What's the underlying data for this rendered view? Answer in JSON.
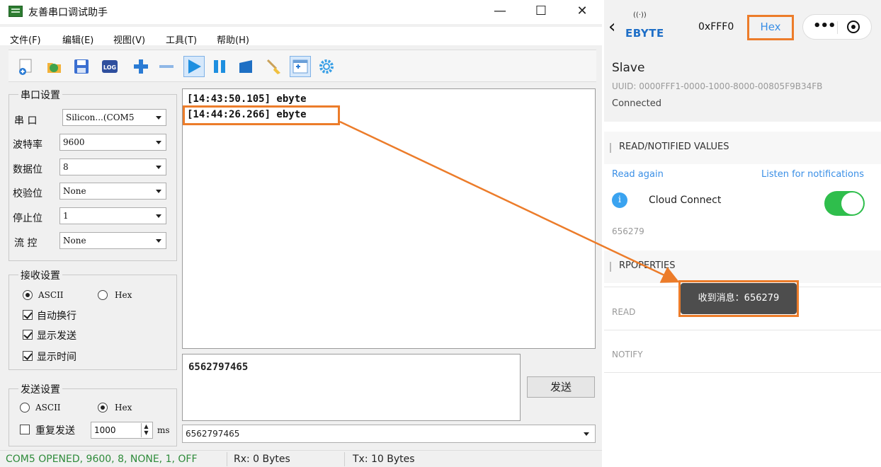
{
  "window": {
    "title": "友善串口调试助手",
    "minimize_glyph": "—",
    "maximize_glyph": "☐",
    "close_glyph": "✕"
  },
  "menu": {
    "file": "文件(F)",
    "edit": "编辑(E)",
    "view": "视图(V)",
    "tools": "工具(T)",
    "help": "帮助(H)"
  },
  "toolbar": {
    "icons": [
      "new-connection-icon",
      "open-icon",
      "save-icon",
      "log-icon",
      "add-icon",
      "remove-icon",
      "play-icon",
      "pause-icon",
      "stop-icon",
      "clear-icon",
      "layout-icon",
      "settings-icon"
    ],
    "log_label": "LOG"
  },
  "serial_settings": {
    "title": "串口设置",
    "port_label": "串 口",
    "port_value": "Silicon...(COM5",
    "baud_label": "波特率",
    "baud_value": "9600",
    "databits_label": "数据位",
    "databits_value": "8",
    "parity_label": "校验位",
    "parity_value": "None",
    "stopbits_label": "停止位",
    "stopbits_value": "1",
    "flow_label": "流 控",
    "flow_value": "None"
  },
  "receive_settings": {
    "title": "接收设置",
    "ascii_label": "ASCII",
    "hex_label": "Hex",
    "selected": "ASCII",
    "auto_wrap_label": "自动换行",
    "show_send_label": "显示发送",
    "show_time_label": "显示时间",
    "auto_wrap": true,
    "show_send": true,
    "show_time": true
  },
  "send_settings": {
    "title": "发送设置",
    "ascii_label": "ASCII",
    "hex_label": "Hex",
    "selected": "Hex",
    "repeat_label": "重复发送",
    "repeat_checked": false,
    "interval_value": "1000",
    "interval_unit": "ms"
  },
  "receive_area": {
    "lines": [
      "[14:43:50.105] ebyte",
      "[14:44:26.266] ebyte"
    ]
  },
  "send_area": {
    "text": "6562797465",
    "send_button": "发送",
    "history_value": "6562797465"
  },
  "status_bar": {
    "connection": "COM5 OPENED, 9600, 8, NONE, 1, OFF",
    "rx": "Rx: 0 Bytes",
    "tx": "Tx: 10 Bytes"
  },
  "phone": {
    "brand": "EBYTE",
    "service_uuid": "0xFFF0",
    "hex_button": "Hex",
    "more_glyph": "•••",
    "device_name": "Slave",
    "device_uuid": "UUID: 0000FFF1-0000-1000-8000-00805F9B34FB",
    "device_status": "Connected",
    "read_notified_title": "READ/NOTIFIED VALUES",
    "read_again": "Read again",
    "listen_notifications": "Listen for notifications",
    "cloud_connect_label": "Cloud Connect",
    "cloud_connect_on": true,
    "value": "656279",
    "properties_title": "RPOPERTIES",
    "read_label": "READ",
    "notify_label": "NOTIFY",
    "toast": "收到消息：656279"
  },
  "colors": {
    "highlight": "#ec7c2a",
    "link": "#3a8fe6",
    "toggle_on": "#2fbe4c",
    "status_text": "#2e8b3a",
    "brand": "#1f6fc7"
  }
}
